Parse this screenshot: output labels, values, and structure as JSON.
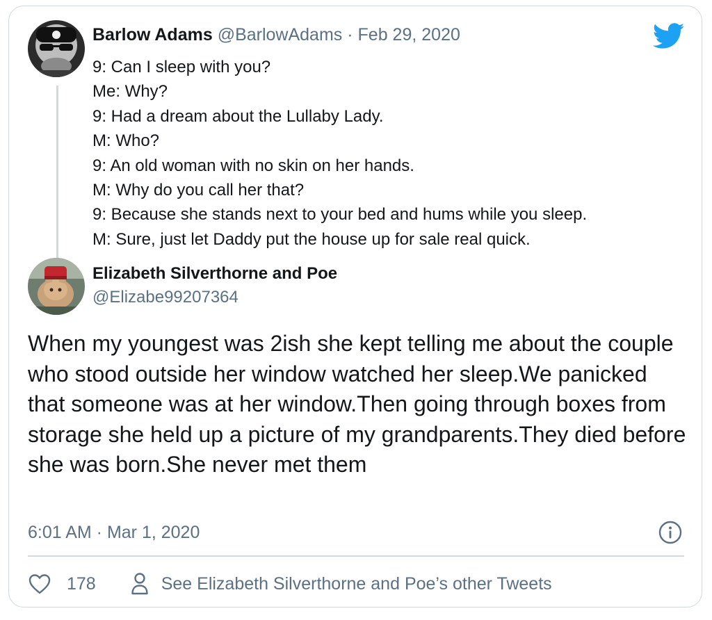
{
  "quoted_tweet": {
    "display_name": "Barlow Adams",
    "handle": "@BarlowAdams",
    "separator": "·",
    "date": "Feb 29, 2020",
    "lines": [
      "9: Can I sleep with you?",
      "Me: Why?",
      "9: Had a dream about the Lullaby Lady.",
      "M: Who?",
      "9: An old woman with no skin on her hands.",
      "M: Why do you call her that?",
      "9: Because she stands next to your bed and hums while you sleep.",
      "M: Sure, just let Daddy put the house up for sale real quick."
    ]
  },
  "tweet": {
    "display_name": "Elizabeth Silverthorne and Poe",
    "handle": "@Elizabe99207364",
    "text": "When my youngest was 2ish she kept telling me about the couple who stood outside her window watched her sleep.We panicked that someone was at her window.Then going through boxes from storage she held up a picture of my grandparents.They died before she was born.She never met them",
    "timestamp": "6:01 AM · Mar 1, 2020",
    "likes": "178",
    "other_tweets_label": "See Elizabeth Silverthorne and Poe’s other Tweets"
  },
  "icons": {
    "brand": "twitter-bird-icon",
    "info": "info-icon",
    "like": "heart-icon",
    "profile": "person-icon"
  },
  "colors": {
    "brand_blue": "#1da1f2",
    "secondary_text": "#5b7083",
    "border": "#cfd9de"
  }
}
